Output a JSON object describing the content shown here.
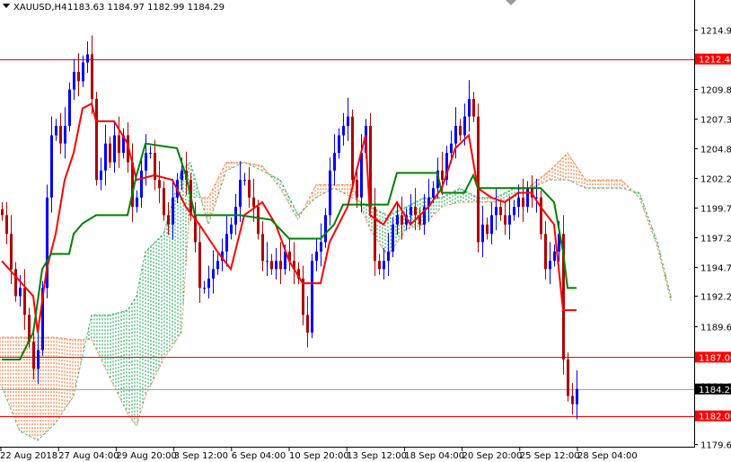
{
  "header": {
    "symbol_label": "XAUUSD,H4",
    "ohlc_label": "1183.63 1184.97 1182.99 1184.29",
    "menu_icon": "triangle-down-icon"
  },
  "colors": {
    "bull": "#0000ff",
    "bear": "#b00000",
    "tenkan": "#ff0000",
    "kijun": "#008000",
    "cloud_bull": "#00a040",
    "cloud_bear": "#ff6010",
    "level_line": "#ff0000",
    "bid_line": "#a0a0a0"
  },
  "chart_data": {
    "type": "candlestick",
    "title": "XAUUSD,H4",
    "ylim": [
      1179.6,
      1215.6
    ],
    "y_ticks": [
      "1214.90",
      "1209.85",
      "1207.30",
      "1204.80",
      "1202.25",
      "1199.75",
      "1197.25",
      "1194.70",
      "1192.20",
      "1189.65",
      "1184.60",
      "1179.60"
    ],
    "y_tick_values": [
      1214.9,
      1209.85,
      1207.3,
      1204.8,
      1202.25,
      1199.75,
      1197.25,
      1194.7,
      1192.2,
      1189.65,
      1184.6,
      1179.6
    ],
    "x_ticks": [
      "22 Aug 2018",
      "27 Aug 04:00",
      "29 Aug 20:00",
      "3 Sep 12:00",
      "6 Sep 04:00",
      "10 Sep 20:00",
      "13 Sep 12:00",
      "18 Sep 04:00",
      "20 Sep 20:00",
      "25 Sep 12:00",
      "28 Sep 04:00"
    ],
    "closes": [
      1199.1,
      1197.5,
      1194.5,
      1192.2,
      1192.9,
      1190.6,
      1188.3,
      1186.0,
      1187.6,
      1192.9,
      1200.6,
      1205.9,
      1206.7,
      1205.2,
      1206.7,
      1209.8,
      1211.3,
      1210.5,
      1212.1,
      1212.8,
      1209.0,
      1202.1,
      1202.9,
      1205.2,
      1203.6,
      1205.9,
      1204.4,
      1205.9,
      1203.6,
      1199.8,
      1200.6,
      1202.9,
      1204.4,
      1204.4,
      1202.1,
      1201.4,
      1199.1,
      1198.3,
      1200.6,
      1202.1,
      1202.9,
      1202.1,
      1199.1,
      1196.8,
      1192.9,
      1192.9,
      1193.7,
      1194.5,
      1195.2,
      1196.0,
      1197.5,
      1198.3,
      1199.8,
      1202.1,
      1202.1,
      1200.6,
      1199.8,
      1197.5,
      1195.2,
      1195.2,
      1194.5,
      1195.2,
      1194.5,
      1196.0,
      1195.2,
      1194.5,
      1193.7,
      1190.6,
      1189.1,
      1195.2,
      1196.0,
      1196.8,
      1199.1,
      1202.9,
      1204.4,
      1205.9,
      1206.7,
      1207.5,
      1202.1,
      1200.6,
      1204.4,
      1206.7,
      1199.8,
      1195.2,
      1194.5,
      1195.2,
      1196.0,
      1198.3,
      1199.1,
      1198.3,
      1199.1,
      1199.8,
      1199.1,
      1198.3,
      1199.8,
      1200.6,
      1201.4,
      1202.9,
      1202.1,
      1204.4,
      1205.2,
      1206.7,
      1205.9,
      1207.5,
      1209.0,
      1207.5,
      1196.8,
      1198.3,
      1197.5,
      1199.1,
      1199.8,
      1199.1,
      1198.3,
      1199.1,
      1199.8,
      1200.6,
      1199.8,
      1201.4,
      1200.6,
      1200.6,
      1197.5,
      1194.5,
      1195.2,
      1196.0,
      1197.5,
      1186.8,
      1183.7,
      1183.0,
      1184.29
    ],
    "tenkan": [
      [
        0,
        1195.2
      ],
      [
        7,
        1192.2
      ],
      [
        8,
        1189.1
      ],
      [
        10,
        1194.5
      ],
      [
        12,
        1197.5
      ],
      [
        14,
        1202.1
      ],
      [
        16,
        1204.4
      ],
      [
        18,
        1208.2
      ],
      [
        20,
        1208.6
      ],
      [
        21,
        1207.1
      ],
      [
        25,
        1207.1
      ],
      [
        28,
        1205.2
      ],
      [
        30,
        1202.1
      ],
      [
        34,
        1202.5
      ],
      [
        38,
        1202.1
      ],
      [
        41,
        1199.8
      ],
      [
        44,
        1198.3
      ],
      [
        48,
        1196.0
      ],
      [
        51,
        1194.5
      ],
      [
        54,
        1199.1
      ],
      [
        58,
        1200.2
      ],
      [
        61,
        1198.3
      ],
      [
        64,
        1195.2
      ],
      [
        67,
        1193.3
      ],
      [
        71,
        1193.3
      ],
      [
        73,
        1196.8
      ],
      [
        75,
        1198.3
      ],
      [
        77,
        1199.8
      ],
      [
        79,
        1202.9
      ],
      [
        81,
        1205.9
      ],
      [
        82,
        1199.1
      ],
      [
        85,
        1198.3
      ],
      [
        88,
        1200.2
      ],
      [
        91,
        1198.3
      ],
      [
        95,
        1199.8
      ],
      [
        98,
        1201.4
      ],
      [
        101,
        1204.8
      ],
      [
        104,
        1205.9
      ],
      [
        106,
        1201.4
      ],
      [
        109,
        1200.6
      ],
      [
        112,
        1200.2
      ],
      [
        115,
        1201.0
      ],
      [
        118,
        1201.0
      ],
      [
        120,
        1199.8
      ],
      [
        123,
        1198.3
      ],
      [
        125,
        1191.0
      ],
      [
        128,
        1191.0
      ]
    ],
    "kijun": [
      [
        0,
        1186.8
      ],
      [
        4,
        1186.8
      ],
      [
        7,
        1189.1
      ],
      [
        9,
        1194.5
      ],
      [
        11,
        1195.8
      ],
      [
        15,
        1195.8
      ],
      [
        16,
        1197.5
      ],
      [
        18,
        1198.4
      ],
      [
        21,
        1199.1
      ],
      [
        28,
        1199.1
      ],
      [
        30,
        1202.5
      ],
      [
        32,
        1205.2
      ],
      [
        39,
        1204.8
      ],
      [
        41,
        1202.5
      ],
      [
        43,
        1199.1
      ],
      [
        53,
        1199.1
      ],
      [
        60,
        1198.7
      ],
      [
        64,
        1197.1
      ],
      [
        71,
        1197.1
      ],
      [
        74,
        1198.3
      ],
      [
        76,
        1200.0
      ],
      [
        79,
        1200.0
      ],
      [
        86,
        1200.0
      ],
      [
        88,
        1202.7
      ],
      [
        97,
        1202.7
      ],
      [
        98,
        1201.0
      ],
      [
        103,
        1201.0
      ],
      [
        105,
        1202.5
      ],
      [
        106,
        1201.4
      ],
      [
        120,
        1201.4
      ],
      [
        123,
        1200.2
      ],
      [
        125,
        1196.0
      ],
      [
        126,
        1192.9
      ],
      [
        128,
        1192.9
      ]
    ],
    "span_a": [
      [
        0,
        1184.5
      ],
      [
        4,
        1180.7
      ],
      [
        8,
        1179.9
      ],
      [
        12,
        1181.4
      ],
      [
        16,
        1183.7
      ],
      [
        20,
        1190.6
      ],
      [
        24,
        1190.6
      ],
      [
        28,
        1191.0
      ],
      [
        30,
        1192.2
      ],
      [
        32,
        1196.0
      ],
      [
        36,
        1197.5
      ],
      [
        40,
        1202.9
      ],
      [
        42,
        1203.6
      ],
      [
        46,
        1198.3
      ],
      [
        50,
        1202.9
      ],
      [
        54,
        1203.6
      ],
      [
        58,
        1202.9
      ],
      [
        62,
        1202.1
      ],
      [
        66,
        1199.1
      ],
      [
        70,
        1200.6
      ],
      [
        74,
        1201.4
      ],
      [
        78,
        1200.6
      ],
      [
        82,
        1199.8
      ],
      [
        86,
        1199.1
      ],
      [
        90,
        1199.8
      ],
      [
        94,
        1200.6
      ],
      [
        98,
        1200.6
      ],
      [
        102,
        1201.4
      ],
      [
        106,
        1200.6
      ],
      [
        110,
        1200.6
      ],
      [
        114,
        1201.4
      ],
      [
        118,
        1201.4
      ],
      [
        122,
        1202.1
      ],
      [
        126,
        1202.1
      ],
      [
        130,
        1201.4
      ],
      [
        134,
        1201.4
      ],
      [
        138,
        1201.4
      ],
      [
        142,
        1201.0
      ],
      [
        146,
        1196.8
      ],
      [
        149,
        1192.2
      ]
    ],
    "span_b": [
      [
        0,
        1188.7
      ],
      [
        4,
        1188.7
      ],
      [
        8,
        1188.7
      ],
      [
        12,
        1188.7
      ],
      [
        16,
        1188.5
      ],
      [
        20,
        1188.5
      ],
      [
        24,
        1185.3
      ],
      [
        28,
        1182.2
      ],
      [
        30,
        1181.1
      ],
      [
        32,
        1183.7
      ],
      [
        36,
        1186.8
      ],
      [
        40,
        1189.1
      ],
      [
        42,
        1200.6
      ],
      [
        46,
        1200.6
      ],
      [
        50,
        1203.6
      ],
      [
        54,
        1203.6
      ],
      [
        58,
        1203.3
      ],
      [
        62,
        1201.4
      ],
      [
        66,
        1198.7
      ],
      [
        70,
        1201.7
      ],
      [
        74,
        1201.7
      ],
      [
        78,
        1201.7
      ],
      [
        82,
        1197.9
      ],
      [
        86,
        1195.6
      ],
      [
        90,
        1197.9
      ],
      [
        94,
        1198.3
      ],
      [
        98,
        1199.8
      ],
      [
        102,
        1200.2
      ],
      [
        106,
        1200.2
      ],
      [
        110,
        1200.2
      ],
      [
        114,
        1200.6
      ],
      [
        118,
        1201.7
      ],
      [
        122,
        1202.9
      ],
      [
        126,
        1204.4
      ],
      [
        130,
        1202.1
      ],
      [
        134,
        1202.1
      ],
      [
        138,
        1202.1
      ],
      [
        142,
        1200.6
      ],
      [
        146,
        1196.4
      ],
      [
        149,
        1191.8
      ]
    ],
    "levels": [
      {
        "price": 1212.4,
        "label": "1212.40"
      },
      {
        "price": 1187.0,
        "label": "1187.00"
      },
      {
        "price": 1182.0,
        "label": "1182.00"
      }
    ],
    "bid": {
      "price": 1184.29,
      "label": "1184.29"
    }
  }
}
